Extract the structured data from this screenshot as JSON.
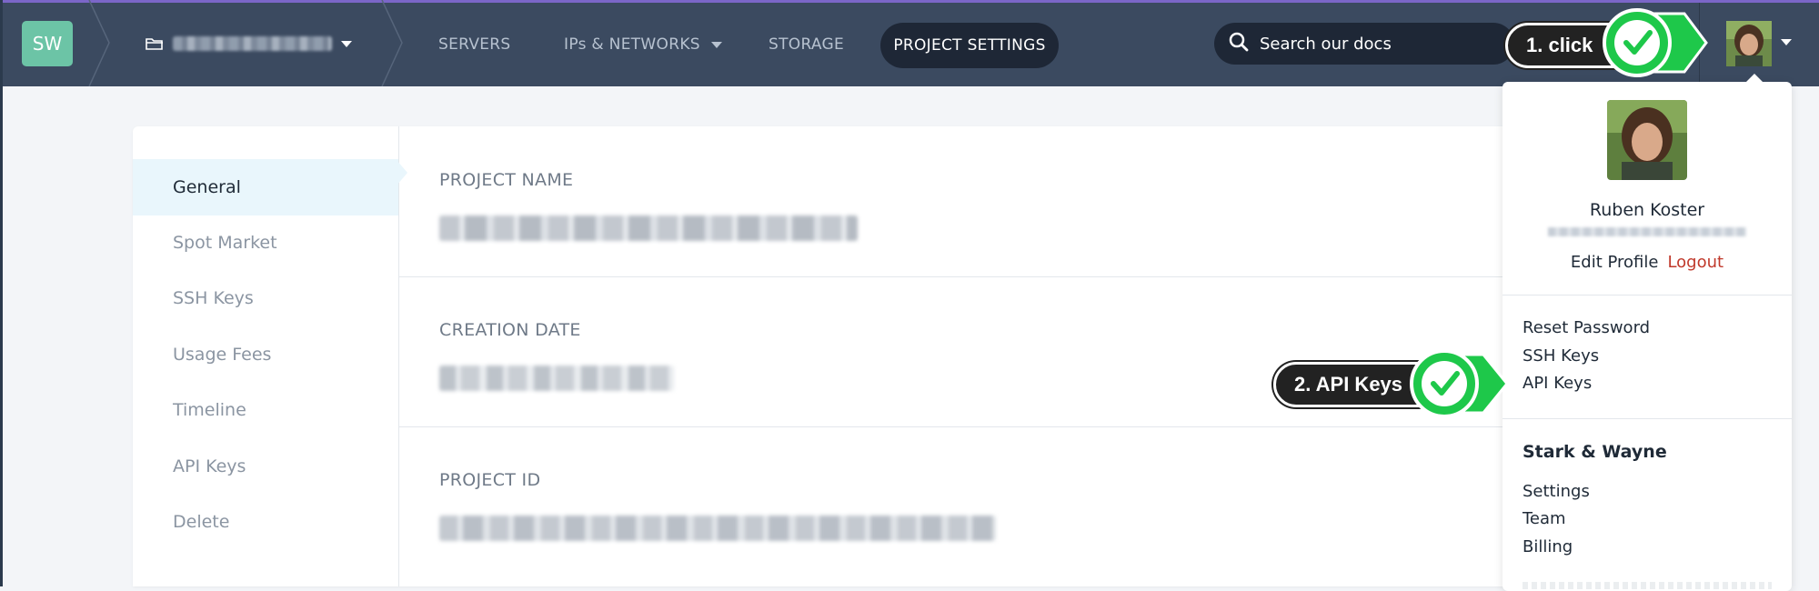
{
  "brand": {
    "initials": "SW"
  },
  "nav": {
    "items": [
      {
        "label": "SERVERS"
      },
      {
        "label": "IPs & NETWORKS"
      },
      {
        "label": "STORAGE"
      }
    ],
    "active_label": "PROJECT SETTINGS"
  },
  "search": {
    "placeholder": "Search our docs"
  },
  "sidebar": {
    "items": [
      {
        "label": "General",
        "active": true
      },
      {
        "label": "Spot Market"
      },
      {
        "label": "SSH Keys"
      },
      {
        "label": "Usage Fees"
      },
      {
        "label": "Timeline"
      },
      {
        "label": "API Keys"
      },
      {
        "label": "Delete"
      }
    ]
  },
  "sections": {
    "project_name": {
      "label": "PROJECT NAME"
    },
    "creation_date": {
      "label": "CREATION DATE"
    },
    "project_id": {
      "label": "PROJECT ID"
    }
  },
  "user_menu": {
    "name": "Ruben Koster",
    "edit_profile": "Edit Profile",
    "logout": "Logout",
    "account_items": [
      "Reset Password",
      "SSH Keys",
      "API Keys"
    ],
    "org_name": "Stark & Wayne",
    "org_items": [
      "Settings",
      "Team",
      "Billing"
    ]
  },
  "annotations": {
    "step1": "1. click",
    "step2": "2. API Keys"
  },
  "colors": {
    "topbar": "#3b4a60",
    "accent_green": "#1ec84a",
    "logout": "#c0392b",
    "brand": "#6cc4a6"
  }
}
